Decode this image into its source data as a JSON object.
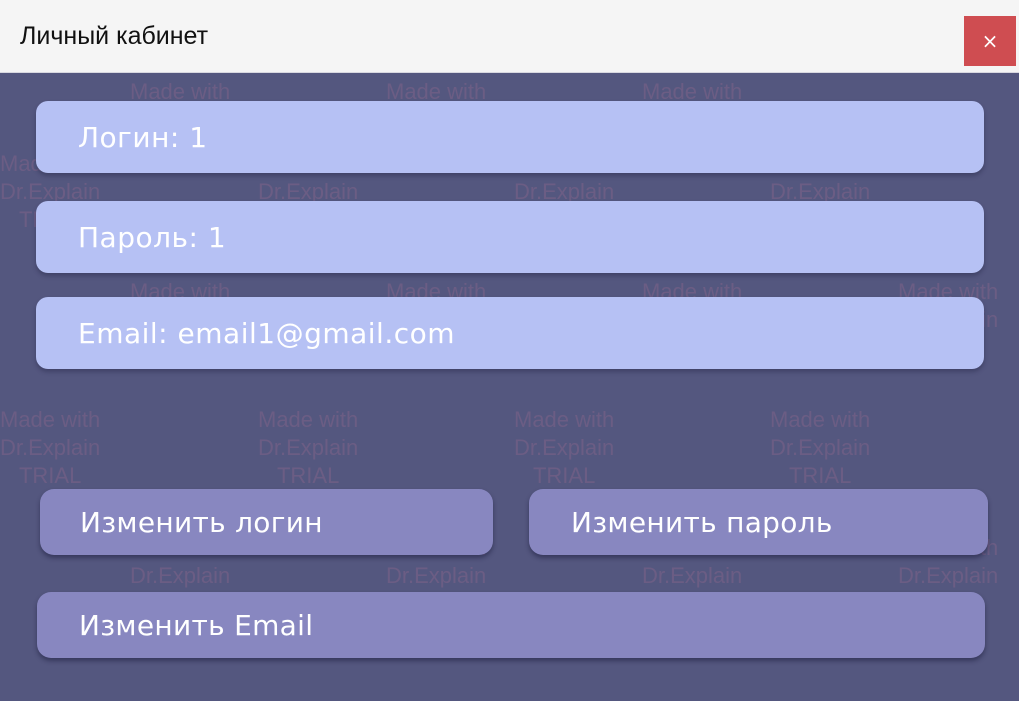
{
  "window": {
    "title": "Личный кабинет",
    "close_label": "×"
  },
  "fields": {
    "login": {
      "label": "Логин:",
      "value": "1"
    },
    "password": {
      "label": "Пароль:",
      "value": "1"
    },
    "email": {
      "label": "Email:",
      "value": "email1@gmail.com"
    }
  },
  "buttons": {
    "change_login": "Изменить логин",
    "change_password": "Изменить пароль",
    "change_email": "Изменить Email"
  },
  "watermark": {
    "line1": "Made with",
    "line2": "Dr.Explain",
    "line3": "TRIAL"
  },
  "colors": {
    "window_bg": "#54577f",
    "field_bg": "#b6c1f4",
    "button_bg": "#8887c0",
    "close_bg": "#cf4d51",
    "titlebar_bg": "#f5f5f5"
  }
}
